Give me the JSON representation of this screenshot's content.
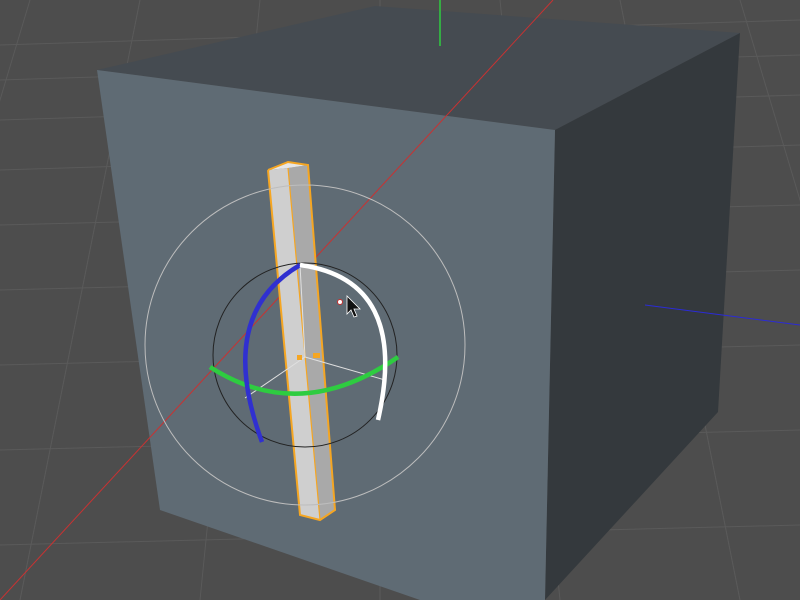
{
  "viewport": {
    "view": "perspective",
    "background_color": "#4d4d4d",
    "grid_color": "#5a5a5a",
    "grid": true
  },
  "scene": {
    "objects": [
      {
        "name": "cube",
        "type": "cube",
        "colors": {
          "front": "#5f6b74",
          "top": "#454b51",
          "right": "#34393d"
        }
      },
      {
        "name": "pillar",
        "type": "cube",
        "selected": true,
        "colors": {
          "front": "#cfcfcf",
          "side": "#a9a9a9",
          "selection_outline": "#f5a623"
        }
      }
    ]
  },
  "world_axes": {
    "x_color": "#c83232",
    "y_color": "#2ecc40",
    "z_color": "#2b2bd6"
  },
  "rotate_gizmo": {
    "active_tool": "rotate",
    "colors": {
      "outer_ring": "#bdbdbd",
      "inner_ring": "#222222",
      "heading_band": "#2ecc40",
      "pitch_band": "#3030d0",
      "bank_band": "#ffffff",
      "axis_lines": "#e0e0e0",
      "pivot": "#f5a623"
    }
  },
  "cursor": {
    "icon": "arrow-cursor-icon"
  }
}
